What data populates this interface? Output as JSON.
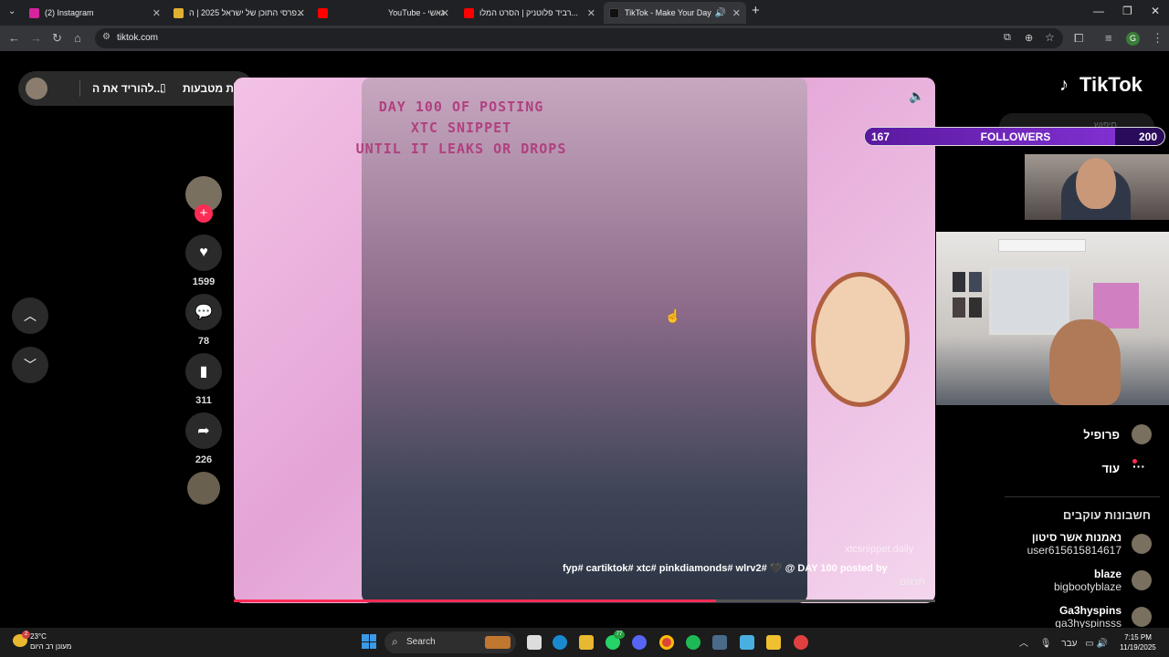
{
  "browser": {
    "tabs": [
      {
        "title": "(2) Instagram",
        "favicon_color": "#d6249f"
      },
      {
        "title": "פרסי התוכן של ישראל 2025 | ה...",
        "favicon_color": "#e0b030"
      },
      {
        "title": "",
        "favicon_color": "#ff0000"
      },
      {
        "title": "YouTube - גאשי",
        "favicon_color": "#ff0000"
      },
      {
        "title": "רביד פלוטניק | הסרט המלו...",
        "favicon_color": "#ff0000"
      },
      {
        "title": "TikTok - Make Your Day",
        "favicon_color": "#111111"
      }
    ],
    "url": "tiktok.com",
    "profile_initial": "G"
  },
  "promo": {
    "coins_label": "קבלת מטבעות",
    "download_label": "להוריד את ה..."
  },
  "video": {
    "overlay_text": [
      "DAY 100 OF POSTING",
      "XTC SNIPPET",
      "UNTIL IT LEAKS OR DROPS"
    ],
    "caption": "fyp# cartiktok# xtc# pinkdiamonds# wlrv2# 🖤 @ DAY 100 posted by",
    "handle": "תרגום",
    "watermark": "xtcsnippet.daily",
    "progress": 0.687
  },
  "actions": {
    "likes": "1599",
    "comments": "78",
    "saves": "311",
    "shares": "226"
  },
  "sidebar": {
    "logo": "TikTok",
    "search_placeholder": "חיפוש",
    "profile": "פרופיל",
    "more": "עוד",
    "following_title": "חשבונות עוקבים",
    "accounts": [
      {
        "name": "נאמנות אשר סיטון",
        "user": "user615615814617"
      },
      {
        "name": "blaze",
        "user": "bigbootyblaze"
      },
      {
        "name": "Ga3hyspins",
        "user": "ga3hyspinsss"
      }
    ]
  },
  "followers_widget": {
    "current": "167",
    "label": "FOLLOWERS",
    "goal": "200",
    "fill_fraction": 0.835
  },
  "taskbar": {
    "temperature": "23°C",
    "weather": "מעונן רב היום",
    "search": "Search",
    "lang": "עבר",
    "time": "7:15 PM",
    "date": "11/19/2025",
    "whatsapp_badge": "77",
    "weather_badge": "2"
  }
}
